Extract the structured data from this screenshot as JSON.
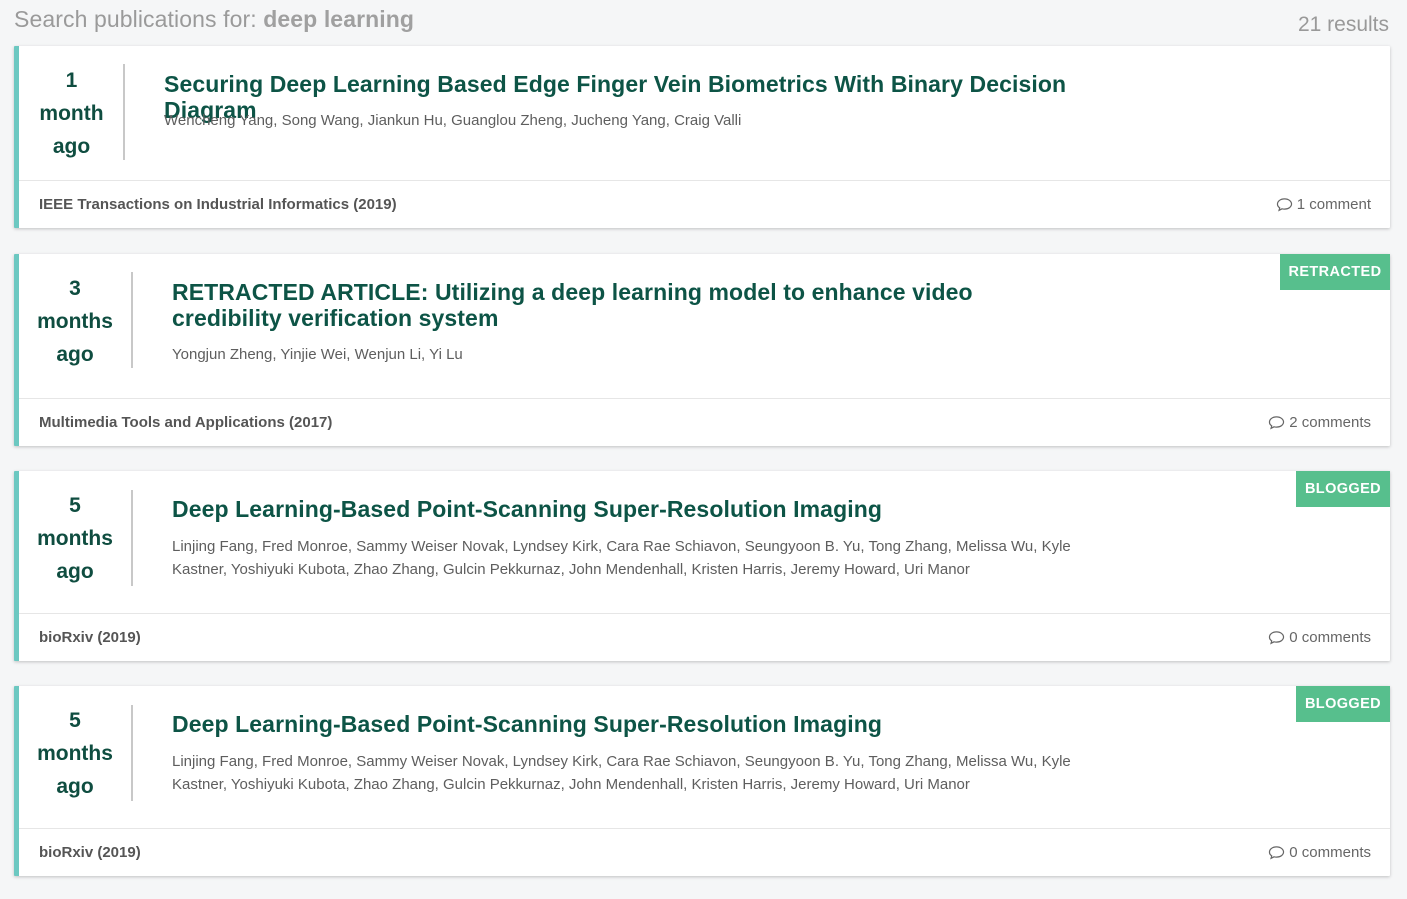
{
  "search": {
    "prefix": "Search publications for: ",
    "query": "deep learning",
    "results": "21 results"
  },
  "colors": {
    "accent_teal": "#6cc8c1",
    "title_green": "#0d5446",
    "badge_green": "#57bf8d"
  },
  "publications": [
    {
      "age": [
        "1",
        "month",
        "ago"
      ],
      "title": "Securing Deep Learning Based Edge Finger Vein Biometrics With Binary Decision Diagram",
      "authors": "Wencheng Yang, Song Wang, Jiankun Hu, Guanglou Zheng, Jucheng Yang, Craig Valli",
      "venue": "IEEE Transactions on Industrial Informatics (2019)",
      "comments": "1 comment",
      "badge": ""
    },
    {
      "age": [
        "3",
        "months",
        "ago"
      ],
      "title": "RETRACTED ARTICLE: Utilizing a deep learning model to enhance video credibility verification system",
      "authors": "Yongjun Zheng, Yinjie Wei, Wenjun Li, Yi Lu",
      "venue": "Multimedia Tools and Applications (2017)",
      "comments": "2 comments",
      "badge": "RETRACTED"
    },
    {
      "age": [
        "5",
        "months",
        "ago"
      ],
      "title": "Deep Learning-Based Point-Scanning Super-Resolution Imaging",
      "authors": "Linjing Fang, Fred Monroe, Sammy Weiser Novak, Lyndsey Kirk, Cara Rae Schiavon, Seungyoon B. Yu, Tong Zhang, Melissa Wu, Kyle Kastner, Yoshiyuki Kubota, Zhao Zhang, Gulcin Pekkurnaz, John Mendenhall, Kristen Harris, Jeremy Howard, Uri Manor",
      "venue": "bioRxiv (2019)",
      "comments": "0 comments",
      "badge": "BLOGGED"
    },
    {
      "age": [
        "5",
        "months",
        "ago"
      ],
      "title": "Deep Learning-Based Point-Scanning Super-Resolution Imaging",
      "authors": "Linjing Fang, Fred Monroe, Sammy Weiser Novak, Lyndsey Kirk, Cara Rae Schiavon, Seungyoon B. Yu, Tong Zhang, Melissa Wu, Kyle Kastner, Yoshiyuki Kubota, Zhao Zhang, Gulcin Pekkurnaz, John Mendenhall, Kristen Harris, Jeremy Howard, Uri Manor",
      "venue": "bioRxiv (2019)",
      "comments": "0 comments",
      "badge": "BLOGGED"
    }
  ]
}
